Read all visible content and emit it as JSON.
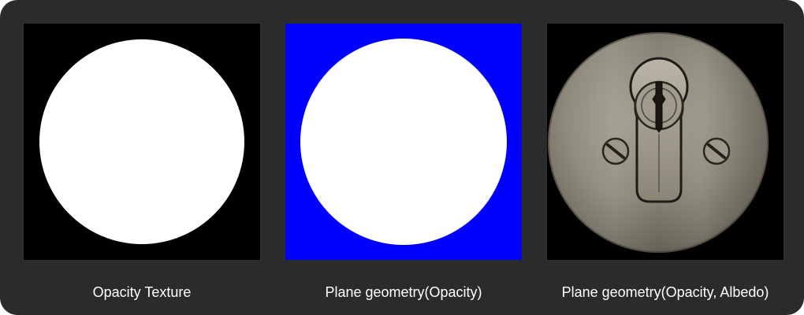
{
  "panels": [
    {
      "caption": "Opacity Texture",
      "background": "#000000",
      "disc_color": "#ffffff"
    },
    {
      "caption": "Plane geometry(Opacity)",
      "background": "#0000ff",
      "disc_color": "#ffffff"
    },
    {
      "caption": "Plane geometry(Opacity, Albedo)",
      "background": "#000000",
      "disc_color": "#8f8a7e"
    }
  ]
}
